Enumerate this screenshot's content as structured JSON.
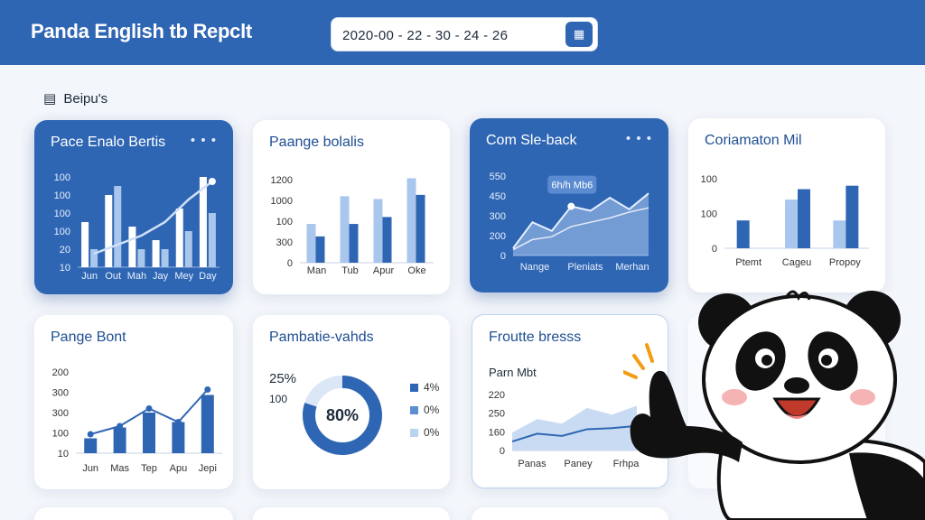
{
  "header": {
    "title": "Panda English tb Repclt",
    "date_range": "2020-00 - 22 - 30 - 24 - 26",
    "calendar_icon": "calendar-icon"
  },
  "breadcrumb": {
    "icon": "chart-icon",
    "label": "Beipu's"
  },
  "colors": {
    "brand": "#2f66b4",
    "bar_dark": "#2f66b4",
    "bar_light": "#a9c6ec",
    "background": "#f3f6fb"
  },
  "cards": {
    "c1": {
      "title": "Pace Enalo Bertis",
      "more": "• • •"
    },
    "c2": {
      "title": "Paange bolalis"
    },
    "c3": {
      "title": "Com Sle-back",
      "more": "• • •",
      "tooltip": "6h/h Mb6"
    },
    "c4": {
      "title": "Coriamaton Mil"
    },
    "c5": {
      "title": "Pange Bont"
    },
    "c6": {
      "title": "Pambatie-vahds",
      "pct_big": "25%",
      "pct_small": "100",
      "center": "80%",
      "legend": [
        "4%",
        "0%",
        "0%"
      ]
    },
    "c7": {
      "title": "Froutte bresss",
      "subtitle": "Parn Mbt"
    }
  },
  "chart_data": [
    {
      "type": "bar",
      "title": "Pace Enalo Bertis",
      "categories": [
        "Jun",
        "Out",
        "Mah",
        "Jay",
        "Mey",
        "Day"
      ],
      "yticks": [
        "100",
        "100",
        "100",
        "100",
        "20",
        "10"
      ],
      "ylim": [
        0,
        100
      ],
      "series": [
        {
          "values": [
            50,
            80,
            45,
            30,
            65,
            100
          ]
        },
        {
          "values": [
            20,
            90,
            20,
            20,
            40,
            60
          ]
        }
      ],
      "overlay_line": [
        15,
        25,
        35,
        50,
        75,
        95
      ]
    },
    {
      "type": "bar",
      "title": "Paange bolalis",
      "categories": [
        "Man",
        "Tub",
        "Apur",
        "Oke"
      ],
      "yticks": [
        "1200",
        "1000",
        "100",
        "300",
        "0"
      ],
      "ylim": [
        0,
        1200
      ],
      "series": [
        {
          "values": [
            560,
            960,
            920,
            1220
          ]
        },
        {
          "values": [
            380,
            560,
            660,
            980
          ]
        }
      ]
    },
    {
      "type": "area",
      "title": "Com Sle-back",
      "categories": [
        "Nange",
        "Pleniats",
        "Merhan"
      ],
      "yticks": [
        "550",
        "450",
        "300",
        "200",
        "0"
      ],
      "ylim": [
        0,
        550
      ],
      "series": [
        {
          "values": [
            50,
            230,
            170,
            340,
            310,
            400,
            320,
            430
          ]
        },
        {
          "values": [
            40,
            110,
            130,
            200,
            230,
            260,
            300,
            330
          ]
        }
      ]
    },
    {
      "type": "bar",
      "title": "Coriamaton Mil",
      "categories": [
        "Ptemt",
        "Cageu",
        "Propoy"
      ],
      "yticks": [
        "100",
        "100",
        "0"
      ],
      "ylim": [
        0,
        100
      ],
      "series": [
        {
          "values": [
            40,
            70,
            40
          ]
        },
        {
          "values": [
            0,
            85,
            90
          ]
        }
      ]
    },
    {
      "type": "bar",
      "title": "Pange Bont",
      "categories": [
        "Jun",
        "Mas",
        "Tep",
        "Apu",
        "Jepi"
      ],
      "yticks": [
        "200",
        "300",
        "300",
        "100",
        "10"
      ],
      "ylim": [
        0,
        300
      ],
      "series": [
        {
          "values": [
            55,
            95,
            150,
            115,
            215
          ]
        }
      ],
      "overlay_line": [
        70,
        100,
        165,
        115,
        235
      ]
    },
    {
      "type": "pie",
      "title": "Pambatie-vahds",
      "values": [
        80,
        20
      ]
    },
    {
      "type": "area",
      "title": "Froutte bresss",
      "categories": [
        "Panas",
        "Paney",
        "Frhpa"
      ],
      "yticks": [
        "220",
        "250",
        "160",
        "0"
      ],
      "ylim": [
        0,
        250
      ],
      "series": [
        {
          "values": [
            80,
            140,
            120,
            190,
            160,
            200
          ]
        },
        {
          "values": [
            40,
            75,
            65,
            95,
            100,
            110
          ]
        }
      ]
    }
  ]
}
